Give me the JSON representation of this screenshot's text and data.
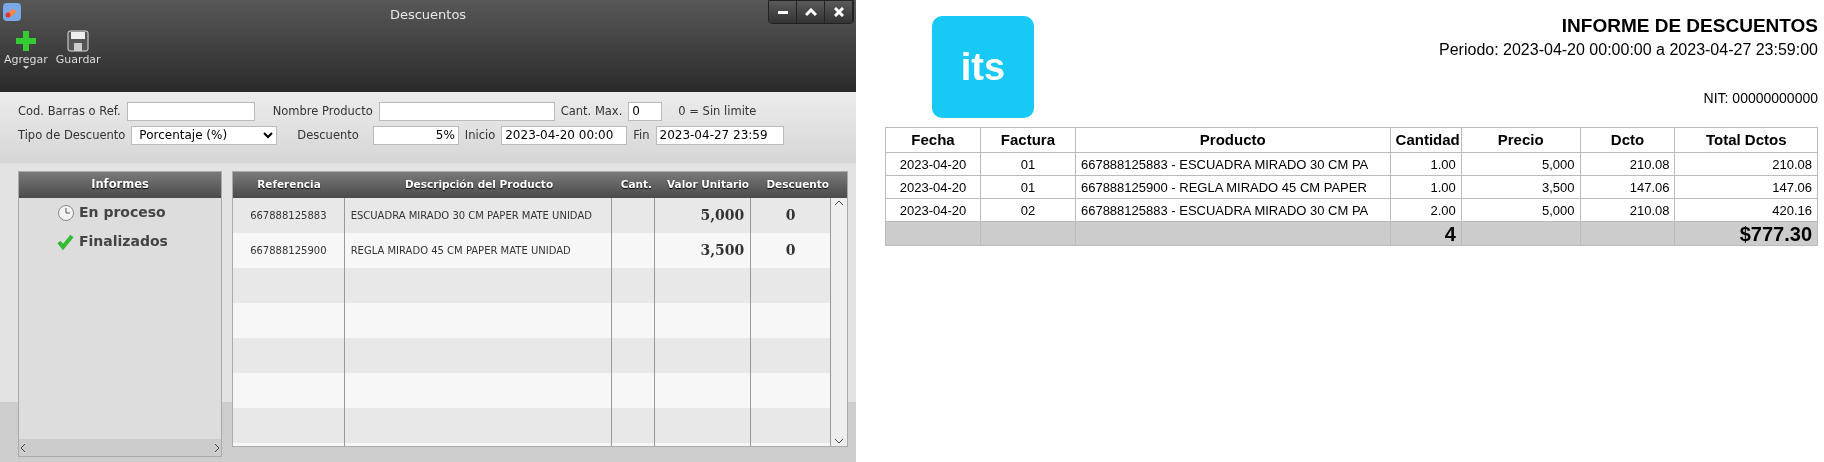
{
  "window": {
    "title": "Descuentos",
    "controls": [
      {
        "kind": "minimize"
      },
      {
        "kind": "maximize"
      },
      {
        "kind": "close"
      }
    ]
  },
  "toolbar": [
    {
      "label": "Agregar",
      "kind": "add",
      "dropdown": true
    },
    {
      "label": "Guardar",
      "kind": "save",
      "dropdown": false
    }
  ],
  "form": {
    "barcode": {
      "label": "Cod. Barras o Ref."
    },
    "product_name": {
      "label": "Nombre Producto"
    },
    "max_qty": {
      "label": "Cant. Max.",
      "value": "0",
      "hint": "0 = Sin limite"
    },
    "discount_type": {
      "label": "Tipo de Descuento",
      "value": "Porcentaje (%)"
    },
    "discount": {
      "label": "Descuento",
      "value": "5%"
    },
    "start": {
      "label": "Inicio",
      "value": "2023-04-20 00:00"
    },
    "end": {
      "label": "Fin",
      "value": "2023-04-27 23:59"
    }
  },
  "reports_panel": {
    "title": "Informes",
    "items": [
      {
        "label": "En proceso",
        "kind": "clock"
      },
      {
        "label": "Finalizados",
        "kind": "check"
      }
    ]
  },
  "grid": {
    "columns": [
      "Referencia",
      "Descripción del Producto",
      "Cant.",
      "Valor Unitario",
      "Descuento"
    ],
    "rows": [
      {
        "reference": "667888125883",
        "description": "ESCUADRA MIRADO 30 CM PAPER MATE UNIDAD",
        "unit_value": "5,000",
        "discount": "0"
      },
      {
        "reference": "667888125900",
        "description": "REGLA MIRADO 45 CM PAPER MATE UNIDAD",
        "unit_value": "3,500",
        "discount": "0"
      }
    ]
  },
  "report": {
    "logo_text": "its",
    "title": "INFORME DE DESCUENTOS",
    "period": "Periodo: 2023-04-20 00:00:00 a 2023-04-27 23:59:00",
    "nit": "NIT: 00000000000",
    "columns": [
      "Fecha",
      "Factura",
      "Producto",
      "Cantidad",
      "Precio",
      "Dcto",
      "Total Dctos"
    ],
    "rows": [
      [
        "2023-04-20",
        "01",
        "667888125883 - ESCUADRA MIRADO 30 CM PA",
        "1.00",
        "5,000",
        "210.08",
        "210.08"
      ],
      [
        "2023-04-20",
        "01",
        "667888125900 - REGLA MIRADO 45 CM PAPER",
        "1.00",
        "3,500",
        "147.06",
        "147.06"
      ],
      [
        "2023-04-20",
        "02",
        "667888125883 - ESCUADRA MIRADO 30 CM PA",
        "2.00",
        "5,000",
        "210.08",
        "420.16"
      ]
    ],
    "totals": {
      "quantity": "4",
      "total": "$777.30"
    }
  }
}
